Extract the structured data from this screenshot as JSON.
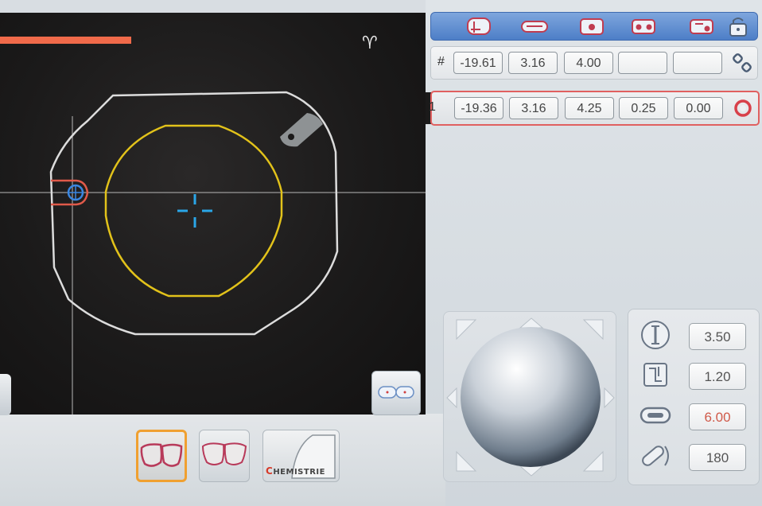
{
  "rows": [
    {
      "label": "#",
      "values": [
        "-19.61",
        "3.16",
        "4.00",
        "",
        ""
      ]
    },
    {
      "label": "1",
      "values": [
        "-19.36",
        "3.16",
        "4.25",
        "0.25",
        "0.00"
      ]
    }
  ],
  "params": [
    {
      "icon": "lens-thickness-icon",
      "value": "3.50"
    },
    {
      "icon": "bevel-depth-icon",
      "value": "1.20"
    },
    {
      "icon": "groove-icon",
      "value": "6.00",
      "color": "#d05a4a"
    },
    {
      "icon": "drill-angle-icon",
      "value": "180"
    }
  ],
  "bottom": {
    "brand_label": "HEMISTRIE",
    "brand_initial": "C"
  },
  "colors": {
    "accent": "#f0a030",
    "toolbar": "#5b88cc",
    "shape_inner": "#e2c21a",
    "marker": "#2aa6e8",
    "alert": "#e06060"
  }
}
